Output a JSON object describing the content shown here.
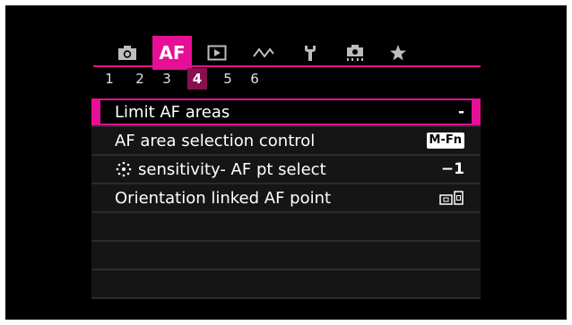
{
  "tabs": [
    {
      "icon": "camera-icon"
    },
    {
      "label": "AF",
      "active": true
    },
    {
      "icon": "playback-icon"
    },
    {
      "icon": "wave-icon"
    },
    {
      "icon": "wrench-icon"
    },
    {
      "icon": "custom-function-icon"
    },
    {
      "icon": "star-icon"
    }
  ],
  "pages": [
    "1",
    "2",
    "3",
    "4",
    "5",
    "6"
  ],
  "active_page": "4",
  "menu": {
    "items": [
      {
        "label": "Limit AF areas",
        "value": "-",
        "selected": true
      },
      {
        "label": "AF area selection control",
        "value": "M-Fn",
        "value_style": "badge"
      },
      {
        "label": "sensitivity- AF pt select",
        "label_icon": "multi-controller-icon",
        "value": "−1"
      },
      {
        "label": "Orientation linked AF point",
        "value_icon": "orientation-af-icon"
      }
    ]
  },
  "colors": {
    "accent": "#e60f95",
    "active_page": "#87104f",
    "background": "#000000"
  }
}
